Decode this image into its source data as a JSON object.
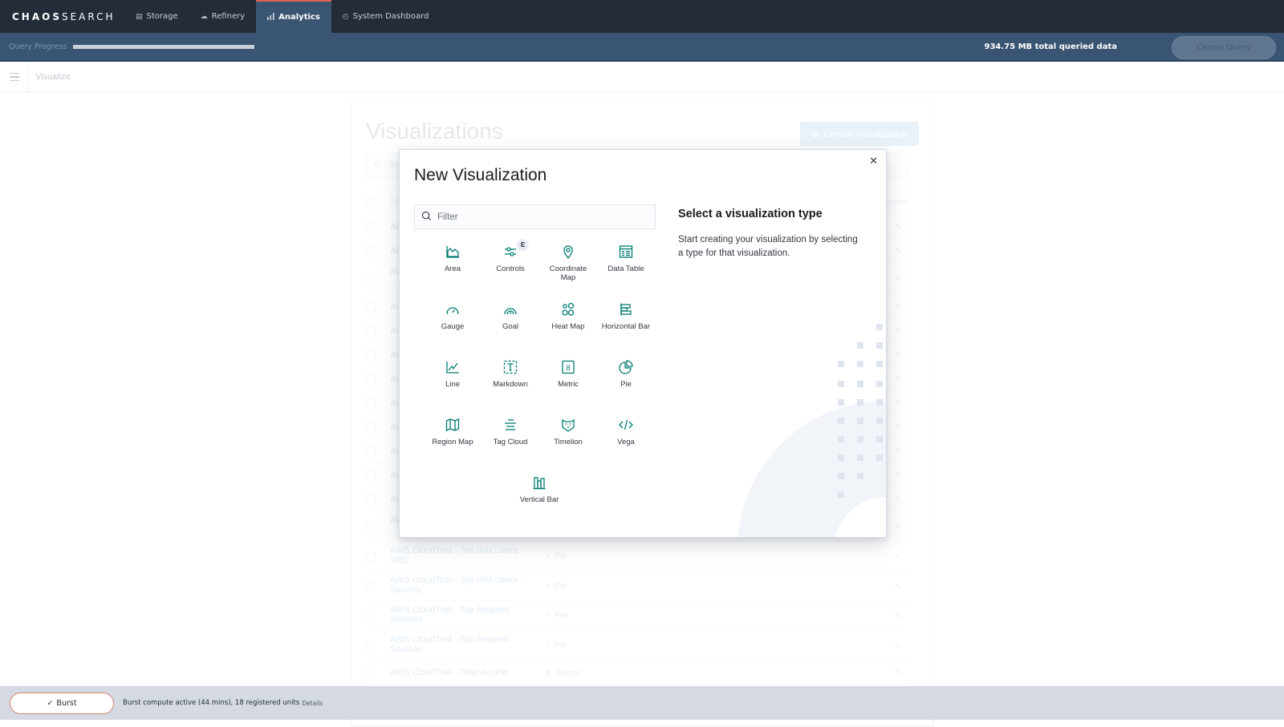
{
  "nav": {
    "logo_bold": "CHAOS",
    "logo_light": "SEARCH",
    "tabs": [
      {
        "label": "Storage",
        "icon": "storage-icon",
        "active": false
      },
      {
        "label": "Refinery",
        "icon": "cloud-icon",
        "active": false
      },
      {
        "label": "Analytics",
        "icon": "bar-chart-icon",
        "active": true
      },
      {
        "label": "System Dashboard",
        "icon": "dashboard-icon",
        "active": false
      }
    ],
    "accent": "#e0644d"
  },
  "query": {
    "label": "Query Progress",
    "progress_percent": 100,
    "total": "934.75 MB total queried data",
    "cancel_label": "Cancel Query"
  },
  "breadcrumb": {
    "current": "Visualize"
  },
  "page": {
    "title": "Visualizations",
    "create_label": "Create visualization",
    "search_placeholder": "Search...",
    "col_title": "Title",
    "col_actions": "Actions",
    "rows": [
      {
        "name": "AC",
        "type": ""
      },
      {
        "name": "AC",
        "type": ""
      },
      {
        "name": "AW by",
        "type": ""
      },
      {
        "name": "AW",
        "type": ""
      },
      {
        "name": "AW",
        "type": ""
      },
      {
        "name": "AW",
        "type": ""
      },
      {
        "name": "AW",
        "type": ""
      },
      {
        "name": "AW",
        "type": ""
      },
      {
        "name": "AW",
        "type": ""
      },
      {
        "name": "AW",
        "type": ""
      },
      {
        "name": "AW",
        "type": ""
      },
      {
        "name": "AW",
        "type": ""
      },
      {
        "name": "AW DevOps",
        "type": ""
      },
      {
        "name": "AWS CloudTrail - Top IAM Users - SRE",
        "type": "Pie"
      },
      {
        "name": "AWS CloudTrail - Top IAM Users - Security",
        "type": "Pie"
      },
      {
        "name": "AWS CloudTrail - Top Request Sources",
        "type": "Pie"
      },
      {
        "name": "AWS CloudTrail - Top Request Sources",
        "type": "Pie"
      },
      {
        "name": "AWS CloudTrail - Total Access",
        "type": "Metric"
      }
    ]
  },
  "modal": {
    "title": "New Visualization",
    "filter_placeholder": "Filter",
    "filter_value": "",
    "side_title": "Select a visualization type",
    "side_desc": "Start creating your visualization by selecting a type for that visualization.",
    "experimental_badge": "E",
    "icon_color": "#017d73",
    "types": [
      {
        "label": "Area",
        "icon": "area-chart-icon"
      },
      {
        "label": "Controls",
        "icon": "controls-icon",
        "badge": "E"
      },
      {
        "label": "Coordinate Map",
        "icon": "map-pin-icon"
      },
      {
        "label": "Data Table",
        "icon": "table-icon"
      },
      {
        "label": "Gauge",
        "icon": "gauge-icon"
      },
      {
        "label": "Goal",
        "icon": "goal-icon"
      },
      {
        "label": "Heat Map",
        "icon": "heatmap-icon"
      },
      {
        "label": "Horizontal Bar",
        "icon": "horizontal-bar-icon"
      },
      {
        "label": "Line",
        "icon": "line-chart-icon"
      },
      {
        "label": "Markdown",
        "icon": "markdown-icon"
      },
      {
        "label": "Metric",
        "icon": "metric-icon"
      },
      {
        "label": "Pie",
        "icon": "pie-chart-icon"
      },
      {
        "label": "Region Map",
        "icon": "region-map-icon"
      },
      {
        "label": "Tag Cloud",
        "icon": "tag-cloud-icon"
      },
      {
        "label": "Timelion",
        "icon": "timelion-icon"
      },
      {
        "label": "Vega",
        "icon": "code-icon"
      },
      {
        "label": "Vertical Bar",
        "icon": "vertical-bar-icon"
      }
    ]
  },
  "bottom": {
    "burst_label": "Burst",
    "burst_text": "Burst compute active (44 mins), 18 registered units",
    "details_label": "Details"
  }
}
